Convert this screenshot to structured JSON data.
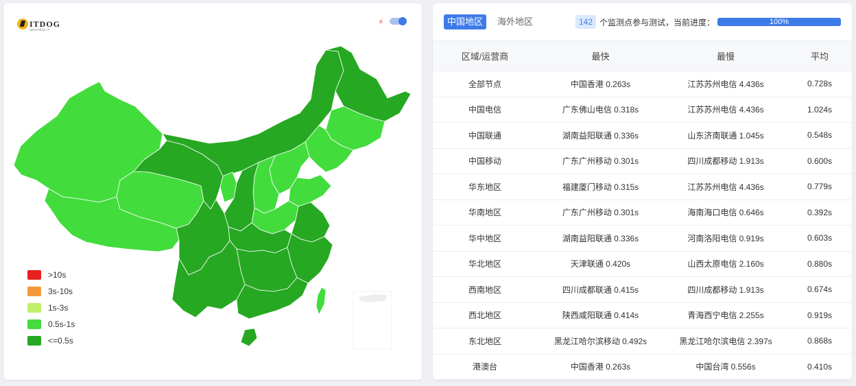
{
  "colors": {
    "accent": "#3d7be8",
    "legend_gt10": "#e8201f",
    "legend_3to10": "#f4993a",
    "legend_1to3": "#c2ef6a",
    "legend_05to1": "#43dc3d",
    "legend_le05": "#26a822"
  },
  "map": {
    "logo_text": "ITDOG",
    "logo_sub": "www.itdog.cn",
    "toggle_on": true,
    "legend": [
      {
        "label": ">10s",
        "color": "#e8201f"
      },
      {
        "label": "3s-10s",
        "color": "#f4993a"
      },
      {
        "label": "1s-3s",
        "color": "#c2ef6a"
      },
      {
        "label": "0.5s-1s",
        "color": "#43dc3d"
      },
      {
        "label": "<=0.5s",
        "color": "#26a822"
      }
    ]
  },
  "tabs": {
    "china": "中国地区",
    "overseas": "海外地区"
  },
  "status": {
    "count": "142",
    "text": "个监测点参与测试，当前进度：",
    "progress_label": "100%",
    "progress_value": 100
  },
  "table": {
    "headers": [
      "区域/运营商",
      "最快",
      "最慢",
      "平均"
    ],
    "rows": [
      [
        "全部节点",
        "中国香港 0.263s",
        "江苏苏州电信 4.436s",
        "0.728s"
      ],
      [
        "中国电信",
        "广东佛山电信 0.318s",
        "江苏苏州电信 4.436s",
        "1.024s"
      ],
      [
        "中国联通",
        "湖南益阳联通 0.336s",
        "山东济南联通 1.045s",
        "0.548s"
      ],
      [
        "中国移动",
        "广东广州移动 0.301s",
        "四川成都移动 1.913s",
        "0.600s"
      ],
      [
        "华东地区",
        "福建厦门移动 0.315s",
        "江苏苏州电信 4.436s",
        "0.779s"
      ],
      [
        "华南地区",
        "广东广州移动 0.301s",
        "海南海口电信 0.646s",
        "0.392s"
      ],
      [
        "华中地区",
        "湖南益阳联通 0.336s",
        "河南洛阳电信 0.919s",
        "0.603s"
      ],
      [
        "华北地区",
        "天津联通 0.420s",
        "山西太原电信 2.160s",
        "0.880s"
      ],
      [
        "西南地区",
        "四川成都联通 0.415s",
        "四川成都移动 1.913s",
        "0.674s"
      ],
      [
        "西北地区",
        "陕西咸阳联通 0.414s",
        "青海西宁电信 2.255s",
        "0.919s"
      ],
      [
        "东北地区",
        "黑龙江哈尔滨移动 0.492s",
        "黑龙江哈尔滨电信 2.397s",
        "0.868s"
      ],
      [
        "港澳台",
        "中国香港 0.263s",
        "中国台湾 0.556s",
        "0.410s"
      ]
    ]
  }
}
